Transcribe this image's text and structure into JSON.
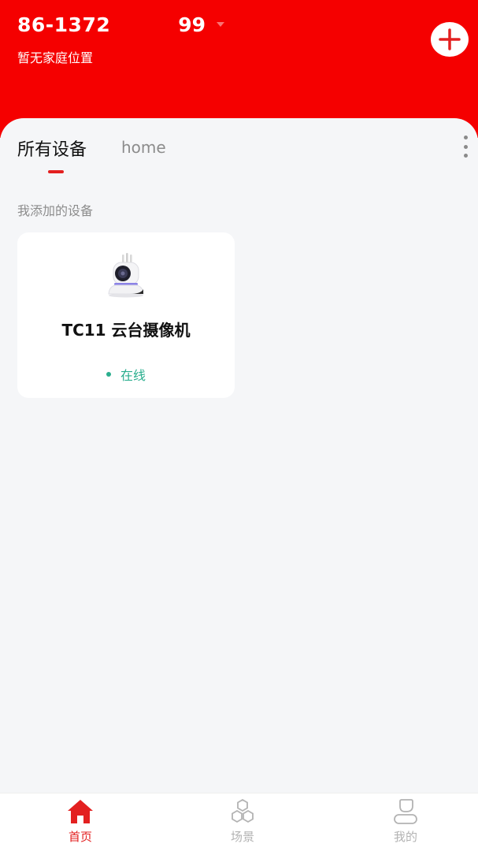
{
  "header": {
    "account_prefix": "86-1372",
    "account_suffix": "99",
    "location": "暂无家庭位置"
  },
  "tabs": {
    "active_label": "所有设备",
    "home_label": "home"
  },
  "section": {
    "title": "我添加的设备"
  },
  "device": {
    "name": "TC11 云台摄像机",
    "status": "在线"
  },
  "tabbar": {
    "items": [
      {
        "label": "首页",
        "icon": "home-icon"
      },
      {
        "label": "场景",
        "icon": "scene-icon"
      },
      {
        "label": "我的",
        "icon": "profile-icon"
      }
    ]
  },
  "colors": {
    "brand_red": "#f50000",
    "accent_red": "#e32020",
    "online_green": "#2aae8e"
  }
}
